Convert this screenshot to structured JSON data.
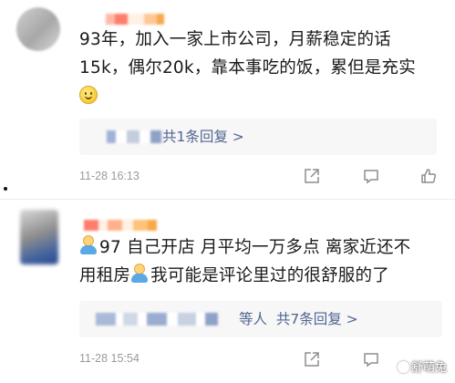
{
  "comments": [
    {
      "content_lines": [
        "93年，加入一家上市公司，月薪稳定的话",
        "15k，偶尔20k，靠本事吃的饭，累但是充实"
      ],
      "emoji": "smile-emoji",
      "reply_summary": "共1条回复 >",
      "timestamp": "11-28 16:13"
    },
    {
      "content_line1": "97 自己开店 月平均一万多点 离家近还不",
      "content_line2_a": "用租房",
      "content_line2_b": "我可能是评论里过的很舒服的了",
      "emoji": "person-emoji",
      "reply_suffix": "等人",
      "reply_summary": "共7条回复 >",
      "timestamp": "11-28 15:54"
    }
  ],
  "actions": {
    "share_icon": "share-square-icon",
    "comment_icon": "comment-bubble-icon",
    "like_icon": "thumbs-up-icon"
  },
  "watermark": {
    "text": "舒萌兔",
    "icon": "wechat-official-account-icon"
  },
  "colors": {
    "reply_link": "#4f6592",
    "reply_bg": "#f7f7f7",
    "timestamp": "#9a9a9a",
    "name_highlight_1": "#ff6d6d",
    "name_highlight_2": "#f7b36b"
  }
}
